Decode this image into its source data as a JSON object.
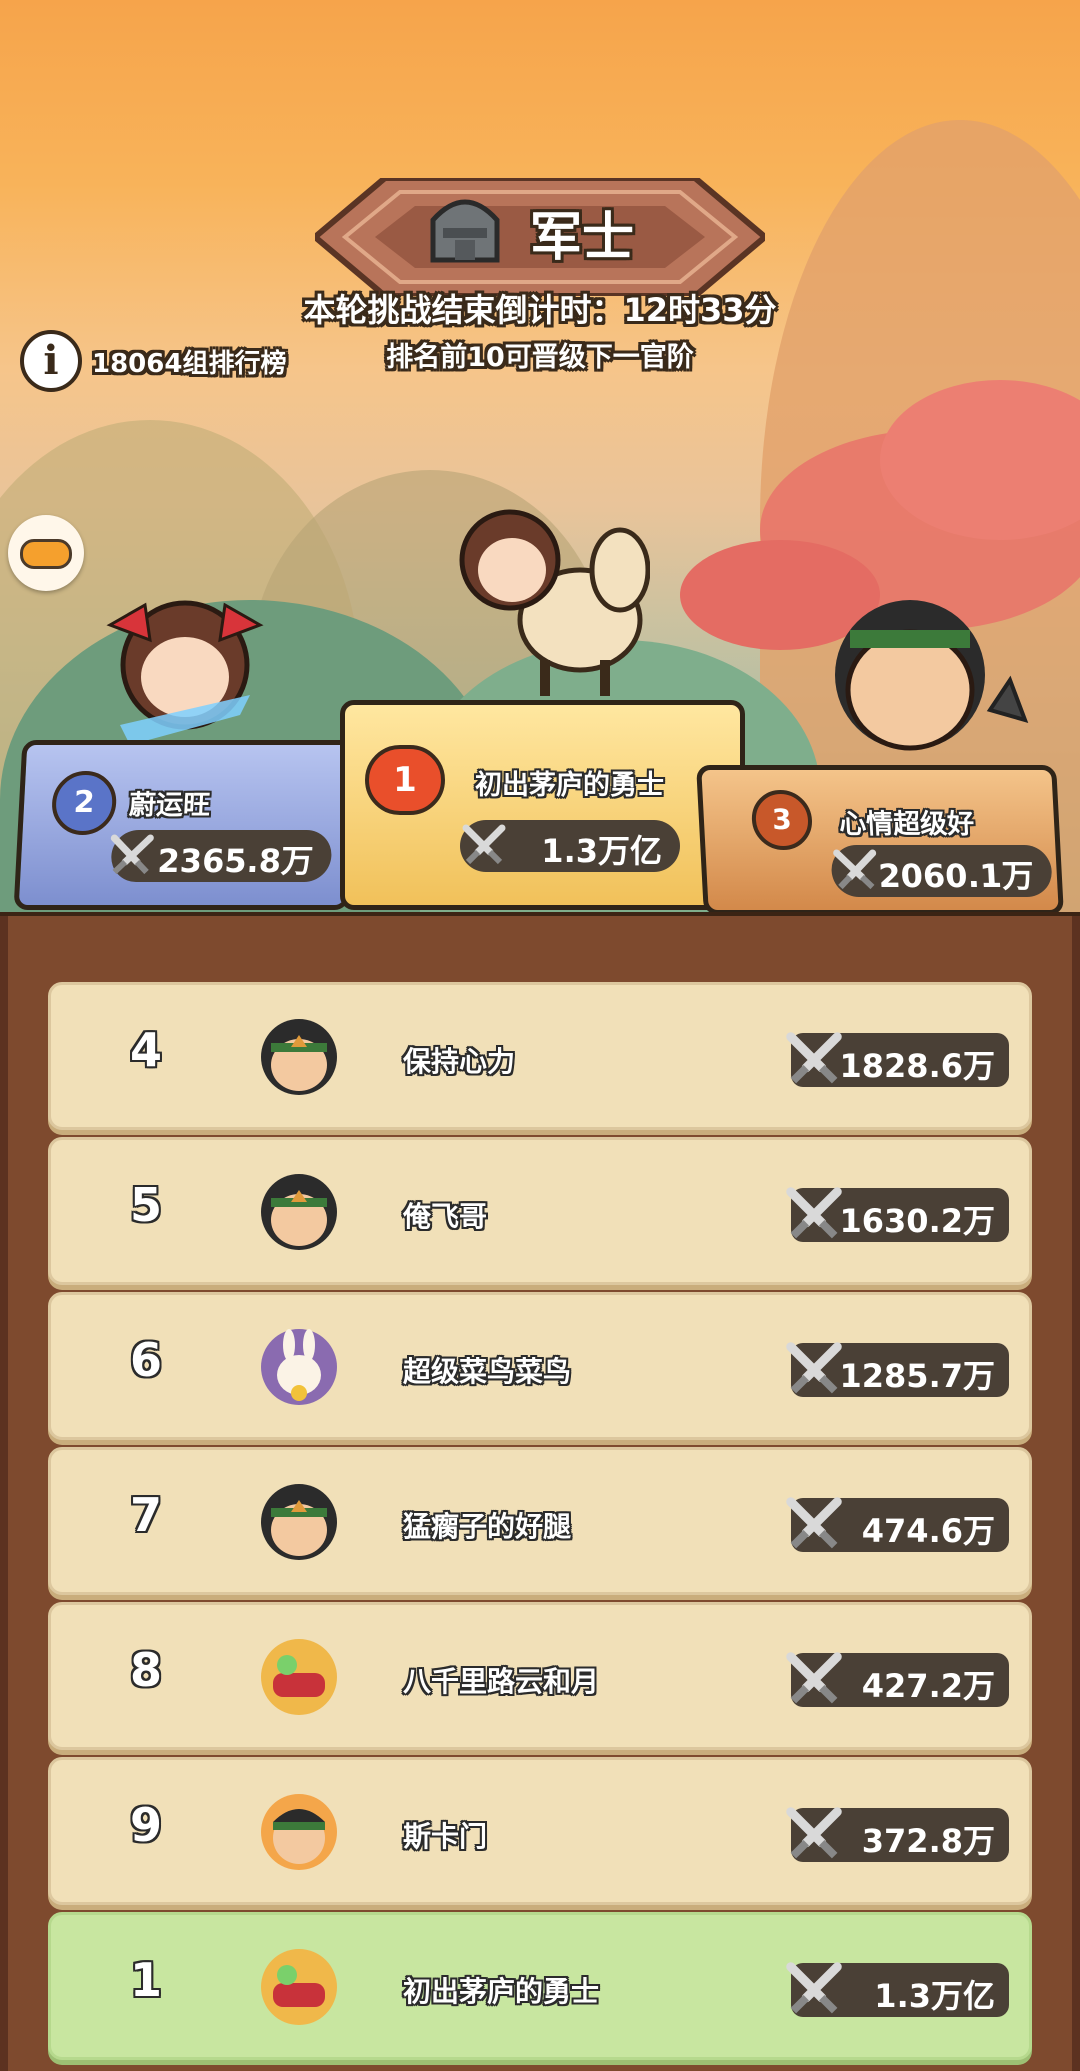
{
  "header": {
    "rank_title": "军士",
    "countdown": "本轮挑战结束倒计时：12时33分",
    "promotion_hint": "排名前10可晋级下一官阶",
    "group_label": "18064组排行榜",
    "info_icon": "info-icon",
    "game_icon": "gamepad-icon"
  },
  "podium": {
    "first": {
      "rank": "1",
      "name": "初出茅庐的勇士",
      "power": "1.3万亿"
    },
    "second": {
      "rank": "2",
      "name": "蔚运旺",
      "power": "2365.8万"
    },
    "third": {
      "rank": "3",
      "name": "心情超级好",
      "power": "2060.1万"
    }
  },
  "leaderboard": [
    {
      "rank": "4",
      "name": "保持心力",
      "power": "1828.6万",
      "avatar": "warrior-avatar"
    },
    {
      "rank": "5",
      "name": "俺飞哥",
      "power": "1630.2万",
      "avatar": "warrior-avatar"
    },
    {
      "rank": "6",
      "name": "超级菜鸟菜鸟",
      "power": "1285.7万",
      "avatar": "rabbit-avatar"
    },
    {
      "rank": "7",
      "name": "猛瘸子的好腿",
      "power": "474.6万",
      "avatar": "warrior-avatar"
    },
    {
      "rank": "8",
      "name": "八千里路云和月",
      "power": "427.2万",
      "avatar": "drum-avatar"
    },
    {
      "rank": "9",
      "name": "斯卡门",
      "power": "372.8万",
      "avatar": "hero-avatar"
    }
  ],
  "self_row": {
    "rank": "1",
    "name": "初出茅庐的勇士",
    "power": "1.3万亿",
    "avatar": "drum-avatar"
  },
  "colors": {
    "board": "#7e4a2e",
    "row": "#f1e0b8",
    "self_row": "#c8e6a0",
    "pill": "#4a4036"
  }
}
